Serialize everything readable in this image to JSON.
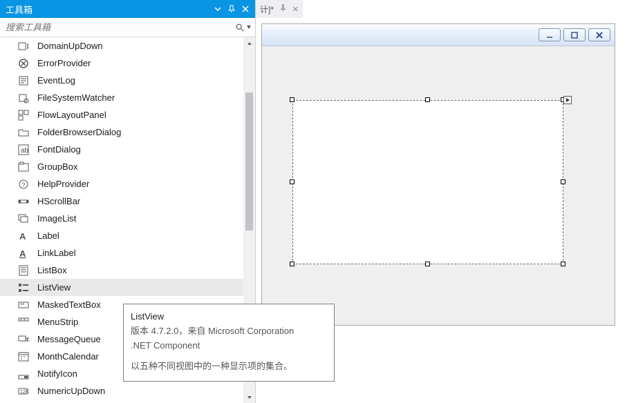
{
  "toolbox": {
    "title": "工具箱",
    "search_placeholder": "搜索工具箱",
    "items": [
      {
        "icon": "updown",
        "label": "DomainUpDown"
      },
      {
        "icon": "error",
        "label": "ErrorProvider"
      },
      {
        "icon": "eventlog",
        "label": "EventLog"
      },
      {
        "icon": "fsw",
        "label": "FileSystemWatcher"
      },
      {
        "icon": "flow",
        "label": "FlowLayoutPanel"
      },
      {
        "icon": "folder",
        "label": "FolderBrowserDialog"
      },
      {
        "icon": "font",
        "label": "FontDialog"
      },
      {
        "icon": "group",
        "label": "GroupBox"
      },
      {
        "icon": "help",
        "label": "HelpProvider"
      },
      {
        "icon": "hscroll",
        "label": "HScrollBar"
      },
      {
        "icon": "imagelist",
        "label": "ImageList"
      },
      {
        "icon": "label",
        "label": "Label"
      },
      {
        "icon": "link",
        "label": "LinkLabel"
      },
      {
        "icon": "listbox",
        "label": "ListBox"
      },
      {
        "icon": "listview",
        "label": "ListView",
        "selected": true
      },
      {
        "icon": "masked",
        "label": "MaskedTextBox"
      },
      {
        "icon": "menu",
        "label": "MenuStrip"
      },
      {
        "icon": "mq",
        "label": "MessageQueue"
      },
      {
        "icon": "cal",
        "label": "MonthCalendar"
      },
      {
        "icon": "notify",
        "label": "NotifyIcon"
      },
      {
        "icon": "numeric",
        "label": "NumericUpDown"
      }
    ]
  },
  "tab": {
    "label_fragment": "计]*"
  },
  "tooltip": {
    "title": "ListView",
    "line1": "版本 4.7.2.0，来自 Microsoft Corporation",
    "line2": ".NET Component",
    "desc": "以五种不同视图中的一种显示项的集合。"
  }
}
